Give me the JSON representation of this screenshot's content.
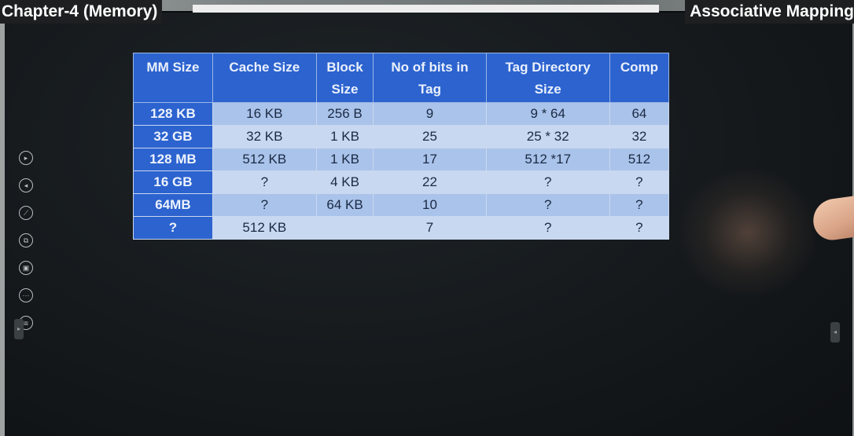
{
  "header": {
    "chapter_title": "Chapter-4 (Memory)",
    "topic_title": "Associative Mapping"
  },
  "toolbar": {
    "tools": [
      {
        "name": "next-page-icon",
        "glyph": "▸"
      },
      {
        "name": "previous-page-icon",
        "glyph": "◂"
      },
      {
        "name": "pen-icon",
        "glyph": "⟋"
      },
      {
        "name": "copy-icon",
        "glyph": "⧉"
      },
      {
        "name": "screenshot-icon",
        "glyph": "▣"
      },
      {
        "name": "more-icon",
        "glyph": "⋯"
      },
      {
        "name": "screen-share-icon",
        "glyph": "⧈"
      }
    ],
    "left_tab_glyph": "▸",
    "right_tab_glyph": "◂"
  },
  "table": {
    "header_color": "#2c63cf",
    "cell_color_dark": "#aac3ea",
    "cell_color_light": "#c8d8f1",
    "columns": [
      [
        "MM Size"
      ],
      [
        "Cache Size"
      ],
      [
        "Block",
        "Size"
      ],
      [
        "No of bits in",
        "Tag"
      ],
      [
        "Tag Directory",
        "Size"
      ],
      [
        "Comp"
      ]
    ],
    "rows": [
      [
        "128 KB",
        "16 KB",
        "256 B",
        "9",
        "9 * 64",
        "64"
      ],
      [
        "32 GB",
        "32 KB",
        "1 KB",
        "25",
        "25 * 32",
        "32"
      ],
      [
        "128 MB",
        "512 KB",
        "1 KB",
        "17",
        "512 *17",
        "512"
      ],
      [
        "16 GB",
        "?",
        "4 KB",
        "22",
        "?",
        "?"
      ],
      [
        "64MB",
        "?",
        "64 KB",
        "10",
        "?",
        "?"
      ],
      [
        "?",
        "512 KB",
        "",
        "7",
        "?",
        "?"
      ]
    ]
  }
}
